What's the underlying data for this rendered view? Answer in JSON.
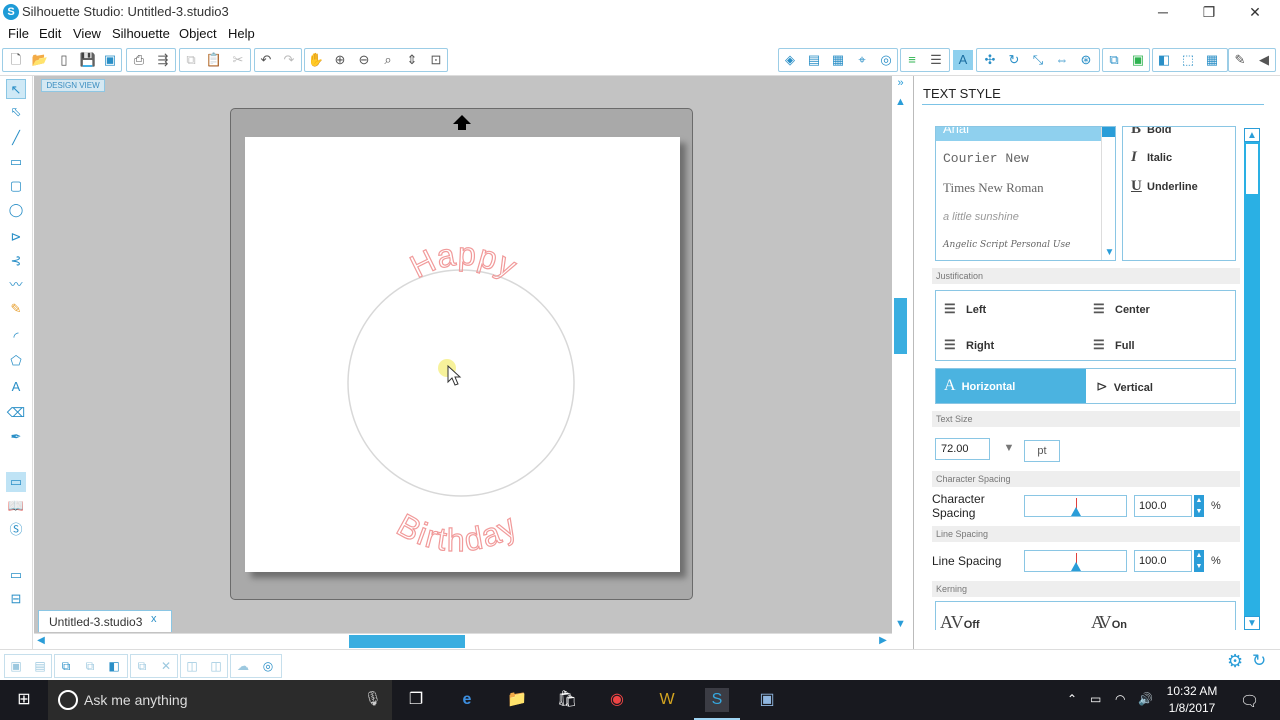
{
  "window": {
    "title": "Silhouette Studio: Untitled-3.studio3",
    "controls": [
      "─",
      "❐",
      "✕"
    ]
  },
  "menu": [
    "File",
    "Edit",
    "View",
    "Silhouette",
    "Object",
    "Help"
  ],
  "canvas": {
    "design_view_label": "DESIGN VIEW",
    "text_top": "Happy",
    "text_bottom": "Birthday",
    "text_color": "#f19a9a"
  },
  "document_tab": {
    "name": "Untitled-3.studio3",
    "close": "x"
  },
  "panel": {
    "title": "TEXT STYLE",
    "fonts": [
      "Arial",
      "Courier New",
      "Times New Roman",
      "a little sunshine",
      "Angelic Script Personal Use"
    ],
    "styles": [
      {
        "glyph": "B",
        "label": "Bold"
      },
      {
        "glyph": "I",
        "label": "Italic"
      },
      {
        "glyph": "U",
        "label": "Underline"
      }
    ],
    "justification": {
      "label": "Justification",
      "left": "Left",
      "center": "Center",
      "right": "Right",
      "full": "Full"
    },
    "orientation": {
      "horizontal": "Horizontal",
      "vertical": "Vertical",
      "selected": "Horizontal"
    },
    "text_size": {
      "label": "Text Size",
      "value": "72.00",
      "unit": "pt"
    },
    "character_spacing": {
      "section": "Character Spacing",
      "label": "Character Spacing",
      "value": "100.0",
      "unit": "%"
    },
    "line_spacing": {
      "section": "Line Spacing",
      "label": "Line Spacing",
      "value": "100.0",
      "unit": "%"
    },
    "kerning": {
      "label": "Kerning",
      "off": "Off",
      "on": "On"
    }
  },
  "taskbar": {
    "search_placeholder": "Ask me anything",
    "time": "10:32 AM",
    "date": "1/8/2017"
  },
  "colors": {
    "accent": "#2a9dd8",
    "canvas_bg": "#c3c3c3",
    "taskbar": "#18191f"
  }
}
